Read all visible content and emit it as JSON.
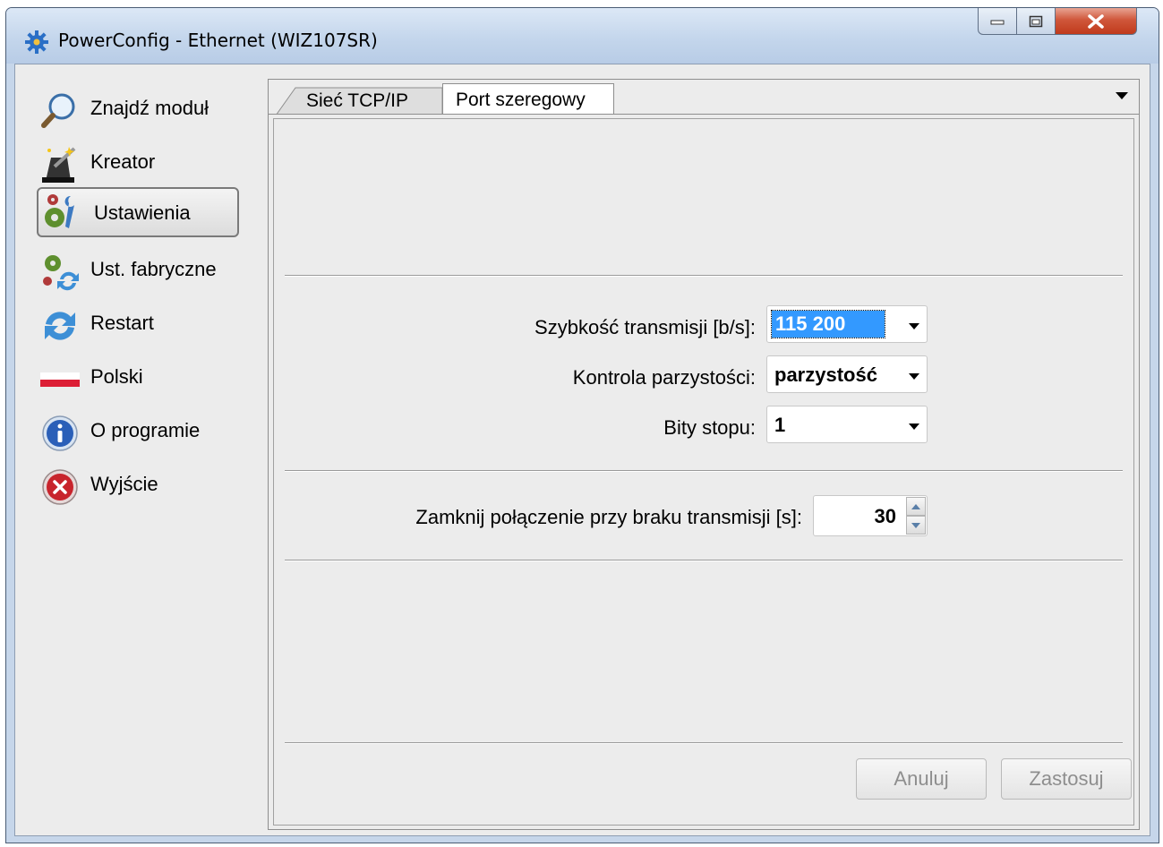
{
  "window": {
    "title": "PowerConfig - Ethernet (WIZ107SR)",
    "controls": {
      "minimize": "minimize",
      "maximize": "maximize",
      "close": "close"
    }
  },
  "sidebar": {
    "items": [
      {
        "label": "Znajdź moduł",
        "icon": "magnifier-icon"
      },
      {
        "label": "Kreator",
        "icon": "magic-wand-hat-icon"
      },
      {
        "label": "Ustawienia",
        "icon": "gears-wrench-icon",
        "active": true
      },
      {
        "label": "Ust. fabryczne",
        "icon": "gears-refresh-icon"
      },
      {
        "label": "Restart",
        "icon": "refresh-icon"
      },
      {
        "label": "Polski",
        "icon": "polish-flag-icon"
      },
      {
        "label": "O programie",
        "icon": "info-icon"
      },
      {
        "label": "Wyjście",
        "icon": "exit-icon"
      }
    ]
  },
  "tabs": [
    {
      "label": "Sieć TCP/IP",
      "selected": false
    },
    {
      "label": "Port szeregowy",
      "selected": true
    }
  ],
  "form": {
    "baud_label": "Szybkość transmisji [b/s]:",
    "baud_value": "115 200",
    "parity_label": "Kontrola parzystości:",
    "parity_value": "parzystość",
    "stopbits_label": "Bity stopu:",
    "stopbits_value": "1",
    "timeout_label": "Zamknij połączenie przy braku transmisji [s]:",
    "timeout_value": "30"
  },
  "buttons": {
    "cancel": "Anuluj",
    "apply": "Zastosuj"
  },
  "colors": {
    "selection": "#3399ff",
    "close_button": "#c94a2c",
    "frame": "#c6d6ea"
  }
}
